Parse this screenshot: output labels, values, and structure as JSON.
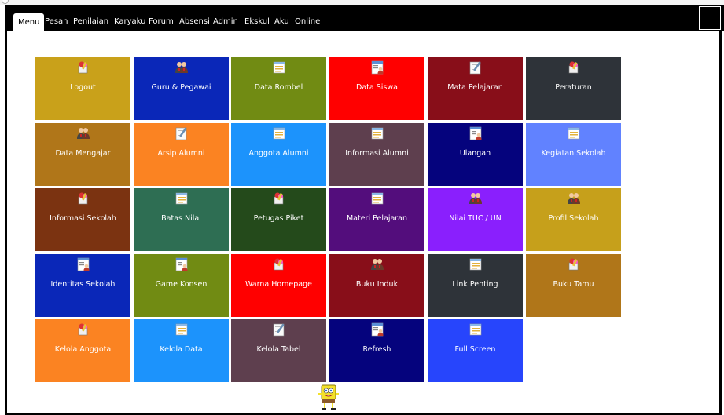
{
  "nav": {
    "tabs": [
      {
        "label": "Menu",
        "active": true
      },
      {
        "label": "Pesan"
      },
      {
        "label": "Penilaian"
      },
      {
        "label": "Karyaku"
      },
      {
        "label": "Forum"
      },
      {
        "label": "Absensi"
      },
      {
        "label": "Admin"
      },
      {
        "label": "Ekskul"
      },
      {
        "label": "Aku"
      },
      {
        "label": "Online"
      }
    ]
  },
  "tiles": [
    {
      "label": "Logout",
      "color": "#c9a11a",
      "icon": "pencil-box-icon"
    },
    {
      "label": "Guru & Pegawai",
      "color": "#0a27b8",
      "icon": "users-icon"
    },
    {
      "label": "Data Rombel",
      "color": "#718b13",
      "icon": "window-icon"
    },
    {
      "label": "Data Siswa",
      "color": "#ff0000",
      "icon": "user-doc-icon"
    },
    {
      "label": "Mata Pelajaran",
      "color": "#880e19",
      "icon": "pen-paper-icon"
    },
    {
      "label": "Peraturan",
      "color": "#2e3339",
      "icon": "pencil-box-icon"
    },
    {
      "label": "Data Mengajar",
      "color": "#b07619",
      "icon": "users-icon"
    },
    {
      "label": "Arsip Alumni",
      "color": "#fb8322",
      "icon": "pen-paper-icon"
    },
    {
      "label": "Anggota Alumni",
      "color": "#1c93fc",
      "icon": "window-icon"
    },
    {
      "label": "Informasi Alumni",
      "color": "#5e3f4e",
      "icon": "window-icon"
    },
    {
      "label": "Ulangan",
      "color": "#05037d",
      "icon": "user-doc-icon"
    },
    {
      "label": "Kegiatan Sekolah",
      "color": "#6182ff",
      "icon": "window-icon"
    },
    {
      "label": "Informasi Sekolah",
      "color": "#7b3311",
      "icon": "pencil-box-icon"
    },
    {
      "label": "Batas Nilai",
      "color": "#2e6e53",
      "icon": "window-icon"
    },
    {
      "label": "Petugas Piket",
      "color": "#244a1b",
      "icon": "pencil-box-icon"
    },
    {
      "label": "Materi Pelajaran",
      "color": "#530d7c",
      "icon": "window-icon"
    },
    {
      "label": "Nilai TUC / UN",
      "color": "#8a1ffd",
      "icon": "users-icon"
    },
    {
      "label": "Profil Sekolah",
      "color": "#c6a01b",
      "icon": "users-icon"
    },
    {
      "label": "Identitas Sekolah",
      "color": "#0a27b8",
      "icon": "user-doc-icon"
    },
    {
      "label": "Game Konsen",
      "color": "#718b13",
      "icon": "user-doc-icon"
    },
    {
      "label": "Warna Homepage",
      "color": "#ff0000",
      "icon": "pencil-box-icon"
    },
    {
      "label": "Buku Induk",
      "color": "#880e19",
      "icon": "users-icon"
    },
    {
      "label": "Link Penting",
      "color": "#2e3339",
      "icon": "window-icon"
    },
    {
      "label": "Buku Tamu",
      "color": "#b07619",
      "icon": "pencil-box-icon"
    },
    {
      "label": "Kelola Anggota",
      "color": "#fb8322",
      "icon": "pencil-box-icon"
    },
    {
      "label": "Kelola Data",
      "color": "#1c93fc",
      "icon": "window-icon"
    },
    {
      "label": "Kelola Tabel",
      "color": "#5e3f4e",
      "icon": "pen-paper-icon"
    },
    {
      "label": "Refresh",
      "color": "#05037d",
      "icon": "user-doc-icon"
    },
    {
      "label": "Full Screen",
      "color": "#2745fc",
      "icon": "window-icon"
    }
  ]
}
